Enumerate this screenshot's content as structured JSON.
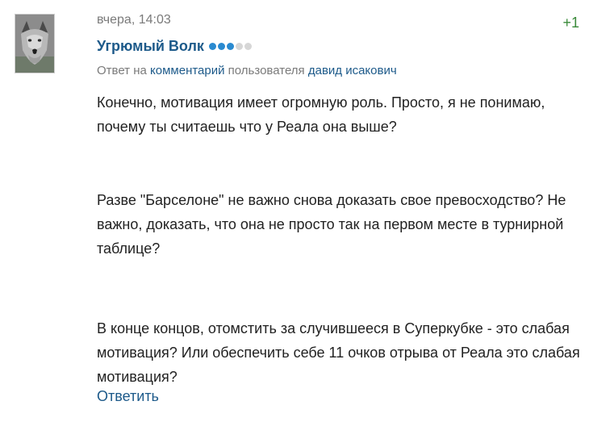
{
  "comment": {
    "timestamp": "вчера, 14:03",
    "rating": "+1",
    "author": {
      "name": "Угрюмый Волк",
      "avatar_icon": "wolf-avatar",
      "level_dots_filled": 3,
      "level_dots_total": 5
    },
    "reply_info": {
      "prefix": "Ответ на",
      "comment_link": "комментарий",
      "middle": "пользователя",
      "user_link": "давид исакович"
    },
    "paragraphs": [
      "Конечно, мотивация имеет огромную роль. Просто, я не понимаю, почему ты считаешь что у Реала она выше?",
      "Разве \"Барселоне\" не важно снова доказать свое превосходство? Не важно, доказать, что она не просто так на первом месте в турнирной таблице?",
      "В конце концов, отомстить за случившееся в Суперкубке - это слабая мотивация? Или обеспечить себе 11 очков отрыва от Реала это слабая мотивация?"
    ],
    "reply_button": "Ответить"
  },
  "colors": {
    "link": "#1d5a8a",
    "rating": "#3a8a3a",
    "dot_active": "#2a8ad0",
    "dot_inactive": "#d6d6d6",
    "meta_text": "#7a7a7a"
  }
}
